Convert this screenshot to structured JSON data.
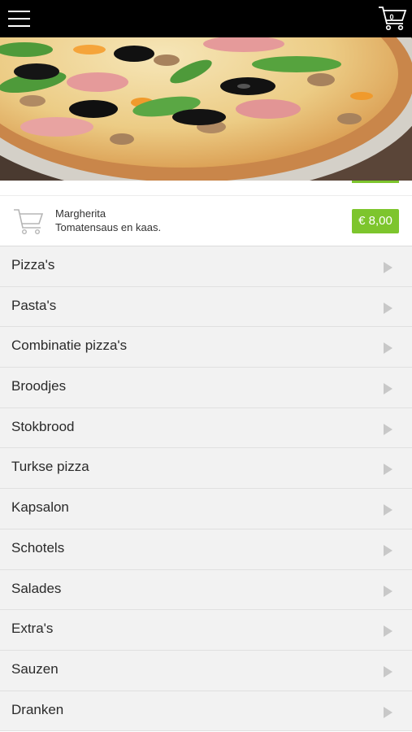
{
  "header": {
    "cart_count": "0"
  },
  "featured_product": {
    "name": "Margherita",
    "description": "Tomatensaus en kaas.",
    "price": "€ 8,00"
  },
  "categories": [
    {
      "label": "Pizza's",
      "icon": "chevron-right-icon"
    },
    {
      "label": "Pasta's",
      "icon": "chevron-right-icon"
    },
    {
      "label": "Combinatie pizza's",
      "icon": "chevron-right-icon"
    },
    {
      "label": "Broodjes",
      "icon": "chevron-right-icon"
    },
    {
      "label": "Stokbrood",
      "icon": "chevron-right-icon"
    },
    {
      "label": "Turkse pizza",
      "icon": "chevron-right-icon"
    },
    {
      "label": "Kapsalon",
      "icon": "chevron-right-icon"
    },
    {
      "label": "Schotels",
      "icon": "chevron-right-icon"
    },
    {
      "label": "Salades",
      "icon": "chevron-right-icon"
    },
    {
      "label": "Extra's",
      "icon": "chevron-right-icon"
    },
    {
      "label": "Sauzen",
      "icon": "chevron-right-icon"
    },
    {
      "label": "Dranken",
      "icon": "chevron-right-icon"
    }
  ],
  "colors": {
    "topbar": "#000000",
    "price_badge": "#7dc52d",
    "list_background": "#f2f2f2"
  }
}
